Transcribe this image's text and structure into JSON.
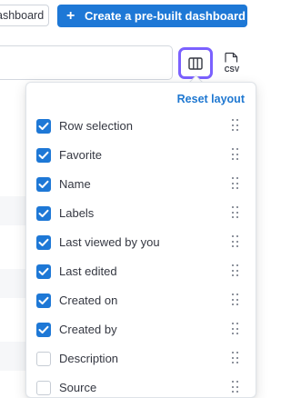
{
  "toolbar": {
    "secondary_label": "Dashboard",
    "primary_label": "Create a pre-built dashboard",
    "csv_label": "CSV"
  },
  "columns_popover": {
    "reset_label": "Reset layout",
    "items": [
      {
        "label": "Row selection",
        "checked": true
      },
      {
        "label": "Favorite",
        "checked": true
      },
      {
        "label": "Name",
        "checked": true
      },
      {
        "label": "Labels",
        "checked": true
      },
      {
        "label": "Last viewed by you",
        "checked": true
      },
      {
        "label": "Last edited",
        "checked": true
      },
      {
        "label": "Created on",
        "checked": true
      },
      {
        "label": "Created by",
        "checked": true
      },
      {
        "label": "Description",
        "checked": false
      },
      {
        "label": "Source",
        "checked": false
      }
    ]
  },
  "colors": {
    "primary": "#1e78d6",
    "focus_ring": "#7b61ff",
    "link": "#1f78d1"
  }
}
